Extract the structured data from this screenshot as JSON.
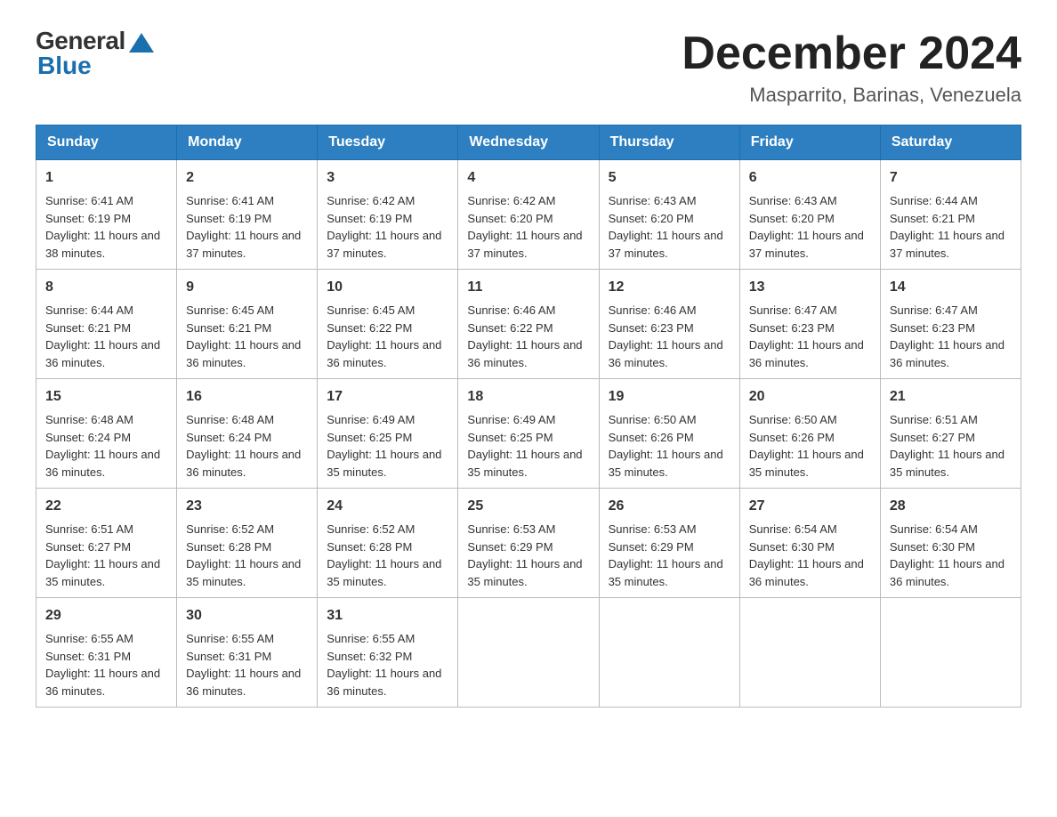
{
  "logo": {
    "general": "General",
    "blue": "Blue"
  },
  "title": "December 2024",
  "location": "Masparrito, Barinas, Venezuela",
  "days_of_week": [
    "Sunday",
    "Monday",
    "Tuesday",
    "Wednesday",
    "Thursday",
    "Friday",
    "Saturday"
  ],
  "weeks": [
    [
      {
        "num": "1",
        "sunrise": "6:41 AM",
        "sunset": "6:19 PM",
        "daylight": "11 hours and 38 minutes."
      },
      {
        "num": "2",
        "sunrise": "6:41 AM",
        "sunset": "6:19 PM",
        "daylight": "11 hours and 37 minutes."
      },
      {
        "num": "3",
        "sunrise": "6:42 AM",
        "sunset": "6:19 PM",
        "daylight": "11 hours and 37 minutes."
      },
      {
        "num": "4",
        "sunrise": "6:42 AM",
        "sunset": "6:20 PM",
        "daylight": "11 hours and 37 minutes."
      },
      {
        "num": "5",
        "sunrise": "6:43 AM",
        "sunset": "6:20 PM",
        "daylight": "11 hours and 37 minutes."
      },
      {
        "num": "6",
        "sunrise": "6:43 AM",
        "sunset": "6:20 PM",
        "daylight": "11 hours and 37 minutes."
      },
      {
        "num": "7",
        "sunrise": "6:44 AM",
        "sunset": "6:21 PM",
        "daylight": "11 hours and 37 minutes."
      }
    ],
    [
      {
        "num": "8",
        "sunrise": "6:44 AM",
        "sunset": "6:21 PM",
        "daylight": "11 hours and 36 minutes."
      },
      {
        "num": "9",
        "sunrise": "6:45 AM",
        "sunset": "6:21 PM",
        "daylight": "11 hours and 36 minutes."
      },
      {
        "num": "10",
        "sunrise": "6:45 AM",
        "sunset": "6:22 PM",
        "daylight": "11 hours and 36 minutes."
      },
      {
        "num": "11",
        "sunrise": "6:46 AM",
        "sunset": "6:22 PM",
        "daylight": "11 hours and 36 minutes."
      },
      {
        "num": "12",
        "sunrise": "6:46 AM",
        "sunset": "6:23 PM",
        "daylight": "11 hours and 36 minutes."
      },
      {
        "num": "13",
        "sunrise": "6:47 AM",
        "sunset": "6:23 PM",
        "daylight": "11 hours and 36 minutes."
      },
      {
        "num": "14",
        "sunrise": "6:47 AM",
        "sunset": "6:23 PM",
        "daylight": "11 hours and 36 minutes."
      }
    ],
    [
      {
        "num": "15",
        "sunrise": "6:48 AM",
        "sunset": "6:24 PM",
        "daylight": "11 hours and 36 minutes."
      },
      {
        "num": "16",
        "sunrise": "6:48 AM",
        "sunset": "6:24 PM",
        "daylight": "11 hours and 36 minutes."
      },
      {
        "num": "17",
        "sunrise": "6:49 AM",
        "sunset": "6:25 PM",
        "daylight": "11 hours and 35 minutes."
      },
      {
        "num": "18",
        "sunrise": "6:49 AM",
        "sunset": "6:25 PM",
        "daylight": "11 hours and 35 minutes."
      },
      {
        "num": "19",
        "sunrise": "6:50 AM",
        "sunset": "6:26 PM",
        "daylight": "11 hours and 35 minutes."
      },
      {
        "num": "20",
        "sunrise": "6:50 AM",
        "sunset": "6:26 PM",
        "daylight": "11 hours and 35 minutes."
      },
      {
        "num": "21",
        "sunrise": "6:51 AM",
        "sunset": "6:27 PM",
        "daylight": "11 hours and 35 minutes."
      }
    ],
    [
      {
        "num": "22",
        "sunrise": "6:51 AM",
        "sunset": "6:27 PM",
        "daylight": "11 hours and 35 minutes."
      },
      {
        "num": "23",
        "sunrise": "6:52 AM",
        "sunset": "6:28 PM",
        "daylight": "11 hours and 35 minutes."
      },
      {
        "num": "24",
        "sunrise": "6:52 AM",
        "sunset": "6:28 PM",
        "daylight": "11 hours and 35 minutes."
      },
      {
        "num": "25",
        "sunrise": "6:53 AM",
        "sunset": "6:29 PM",
        "daylight": "11 hours and 35 minutes."
      },
      {
        "num": "26",
        "sunrise": "6:53 AM",
        "sunset": "6:29 PM",
        "daylight": "11 hours and 35 minutes."
      },
      {
        "num": "27",
        "sunrise": "6:54 AM",
        "sunset": "6:30 PM",
        "daylight": "11 hours and 36 minutes."
      },
      {
        "num": "28",
        "sunrise": "6:54 AM",
        "sunset": "6:30 PM",
        "daylight": "11 hours and 36 minutes."
      }
    ],
    [
      {
        "num": "29",
        "sunrise": "6:55 AM",
        "sunset": "6:31 PM",
        "daylight": "11 hours and 36 minutes."
      },
      {
        "num": "30",
        "sunrise": "6:55 AM",
        "sunset": "6:31 PM",
        "daylight": "11 hours and 36 minutes."
      },
      {
        "num": "31",
        "sunrise": "6:55 AM",
        "sunset": "6:32 PM",
        "daylight": "11 hours and 36 minutes."
      },
      null,
      null,
      null,
      null
    ]
  ],
  "labels": {
    "sunrise": "Sunrise:",
    "sunset": "Sunset:",
    "daylight": "Daylight:"
  }
}
